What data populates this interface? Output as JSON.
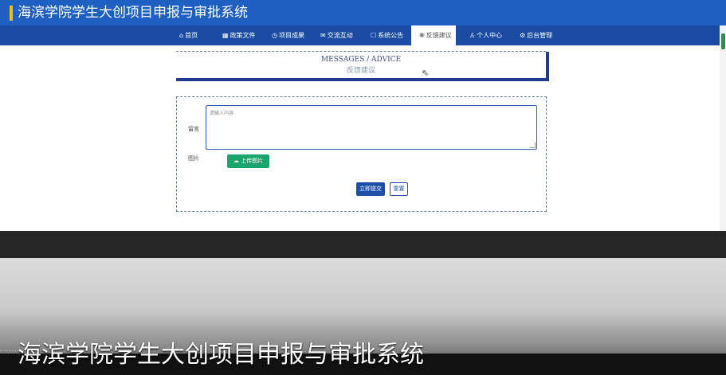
{
  "header": {
    "title": "海滨学院学生大创项目申报与审批系统",
    "accent_color": "#f2c200",
    "bg_color": "#1e5fc2"
  },
  "nav": {
    "items": [
      {
        "icon": "home-icon",
        "glyph": "⌂",
        "label": "首页"
      },
      {
        "icon": "policy-icon",
        "glyph": "▦",
        "label": "政策文件"
      },
      {
        "icon": "project-icon",
        "glyph": "◷",
        "label": "项目成果"
      },
      {
        "icon": "chat-icon",
        "glyph": "✉",
        "label": "交流互动"
      },
      {
        "icon": "notice-icon",
        "glyph": "☐",
        "label": "系统公告"
      },
      {
        "icon": "feedback-icon",
        "glyph": "❋",
        "label": "反馈建议"
      },
      {
        "icon": "user-icon",
        "glyph": "♙",
        "label": "个人中心"
      },
      {
        "icon": "admin-icon",
        "glyph": "⚙",
        "label": "后台管理"
      }
    ],
    "active": "反馈建议"
  },
  "banner": {
    "en": "MESSAGES / ADVICE",
    "cn": "反馈建议"
  },
  "form": {
    "message_label": "留言",
    "message_placeholder": "请输入内容",
    "image_label": "图片",
    "upload_button": "上传图片",
    "submit_button": "立即提交",
    "reset_button": "重置"
  },
  "caption": "海滨学院学生大创项目申报与审批系统"
}
